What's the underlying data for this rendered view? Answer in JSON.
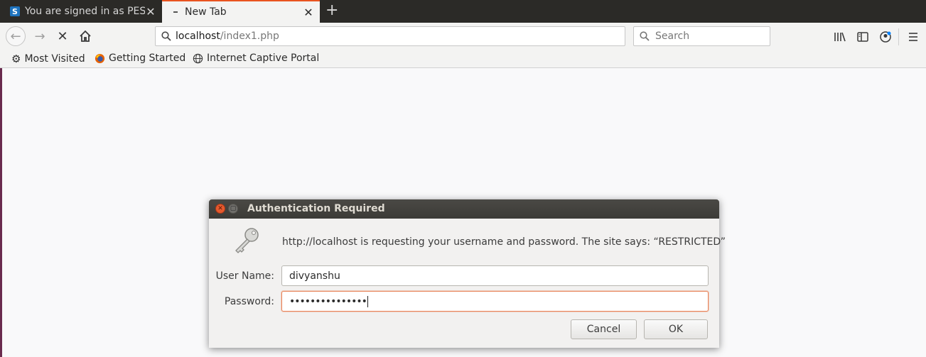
{
  "tabs": [
    {
      "title": "You are signed in as PES",
      "active": false,
      "favicon": "S"
    },
    {
      "title": "New Tab",
      "active": true
    }
  ],
  "new_tab_label": "+",
  "navbar": {
    "url_host": "localhost",
    "url_path": "/index1.php",
    "search_placeholder": "Search"
  },
  "bookmarks": [
    {
      "label": "Most Visited",
      "icon": "gear-icon"
    },
    {
      "label": "Getting Started",
      "icon": "firefox-icon"
    },
    {
      "label": "Internet Captive Portal",
      "icon": "globe-icon"
    }
  ],
  "dialog": {
    "title": "Authentication Required",
    "message": "http://localhost is requesting your username and password. The site says: “RESTRICTED”",
    "username_label": "User Name:",
    "username_value": "divyanshu",
    "password_label": "Password:",
    "password_value": "•••••••••••••••",
    "cancel_label": "Cancel",
    "ok_label": "OK"
  },
  "colors": {
    "accent": "#e95420",
    "titlebar": "#3c3b37",
    "tabstrip": "#2b2a27"
  }
}
